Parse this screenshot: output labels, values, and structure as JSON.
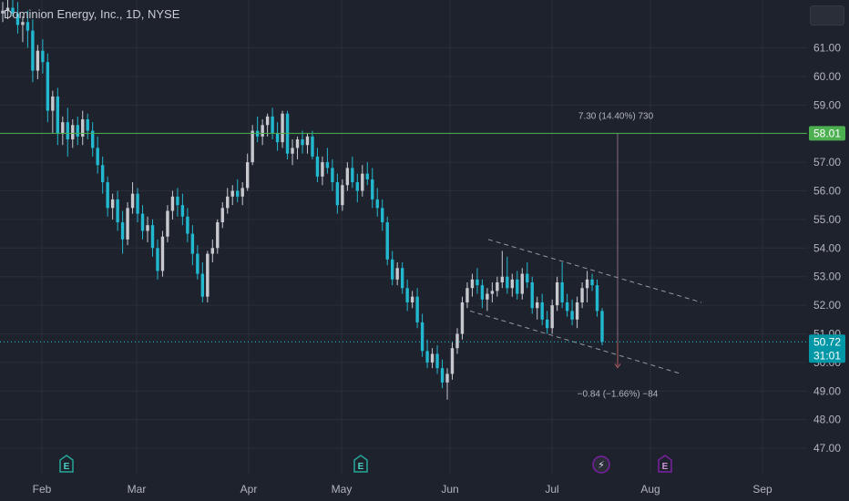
{
  "header": {
    "title": "Dominion Energy, Inc., 1D, NYSE"
  },
  "colors": {
    "background": "#1e222d",
    "up": "#c7c9cf",
    "down": "#22b8cf",
    "resistance_line": "#4caf50",
    "price_line": "#26c6da",
    "grid": "#2a2e39",
    "axis_text": "#b2b5be",
    "channel": "#9598a1",
    "earnings_badge": "#26a69a",
    "dividend_badge": "#7b1fa2"
  },
  "chart_data": {
    "type": "candlestick",
    "title": "Dominion Energy, Inc., 1D, NYSE",
    "ylim": [
      46.6,
      62.1
    ],
    "y_ticks": [
      "61.00",
      "60.00",
      "59.00",
      "58.00",
      "57.00",
      "56.00",
      "55.00",
      "54.00",
      "53.00",
      "52.00",
      "51.00",
      "50.00",
      "49.00",
      "48.00",
      "47.00"
    ],
    "x_ticks": [
      "Feb",
      "Mar",
      "Apr",
      "May",
      "Jun",
      "Jul",
      "Aug",
      "Sep"
    ],
    "horizontal_line": {
      "value": 58.01,
      "label": "58.01"
    },
    "last_price": {
      "value": 50.72,
      "label": "50.72",
      "countdown": "31:01"
    },
    "measure_annotations": {
      "up": "7.30 (14.40%) 730",
      "down": "−0.84 (−1.66%) −84"
    },
    "event_badges": [
      {
        "type": "earnings",
        "label": "E",
        "month": "Feb"
      },
      {
        "type": "earnings",
        "label": "E",
        "month": "May"
      },
      {
        "type": "lightning",
        "label": "⚡",
        "month": "Jul"
      },
      {
        "type": "dividend",
        "label": "E",
        "month": "Aug"
      }
    ],
    "candles": [
      [
        62.2,
        62.6,
        61.9,
        62.3
      ],
      [
        62.3,
        62.7,
        62.0,
        62.4
      ],
      [
        62.4,
        62.8,
        62.1,
        62.2
      ],
      [
        62.2,
        62.6,
        61.5,
        61.8
      ],
      [
        61.8,
        62.1,
        61.2,
        61.9
      ],
      [
        61.9,
        62.3,
        61.0,
        61.6
      ],
      [
        61.6,
        62.0,
        59.8,
        60.2
      ],
      [
        60.2,
        61.1,
        59.9,
        60.9
      ],
      [
        60.9,
        61.3,
        60.1,
        60.5
      ],
      [
        60.5,
        60.8,
        58.4,
        58.8
      ],
      [
        58.8,
        59.5,
        58.0,
        59.3
      ],
      [
        59.3,
        59.6,
        57.6,
        58.0
      ],
      [
        58.0,
        58.6,
        57.6,
        58.4
      ],
      [
        58.4,
        58.9,
        57.2,
        57.8
      ],
      [
        57.8,
        58.5,
        57.5,
        58.3
      ],
      [
        58.3,
        58.6,
        57.6,
        57.9
      ],
      [
        57.9,
        58.8,
        57.6,
        58.5
      ],
      [
        58.5,
        58.7,
        57.8,
        58.1
      ],
      [
        58.1,
        58.4,
        57.2,
        57.5
      ],
      [
        57.5,
        57.9,
        56.6,
        56.9
      ],
      [
        56.9,
        57.2,
        55.9,
        56.3
      ],
      [
        56.3,
        56.5,
        55.1,
        55.4
      ],
      [
        55.4,
        55.9,
        55.0,
        55.7
      ],
      [
        55.7,
        56.0,
        54.6,
        54.9
      ],
      [
        54.9,
        55.3,
        53.8,
        54.3
      ],
      [
        54.3,
        55.6,
        54.1,
        55.4
      ],
      [
        55.4,
        56.3,
        55.2,
        55.9
      ],
      [
        55.9,
        56.1,
        54.9,
        55.2
      ],
      [
        55.2,
        55.5,
        54.3,
        54.6
      ],
      [
        54.6,
        55.1,
        54.2,
        54.8
      ],
      [
        54.8,
        55.0,
        53.7,
        54.0
      ],
      [
        54.0,
        54.3,
        52.9,
        53.2
      ],
      [
        53.2,
        54.6,
        53.0,
        54.4
      ],
      [
        54.4,
        55.5,
        54.2,
        55.3
      ],
      [
        55.3,
        56.0,
        55.0,
        55.8
      ],
      [
        55.8,
        56.1,
        55.1,
        55.5
      ],
      [
        55.5,
        55.9,
        54.8,
        55.1
      ],
      [
        55.1,
        55.4,
        54.2,
        54.5
      ],
      [
        54.5,
        54.8,
        53.4,
        53.8
      ],
      [
        53.8,
        54.1,
        52.9,
        53.1
      ],
      [
        53.1,
        53.5,
        52.1,
        52.3
      ],
      [
        52.3,
        53.9,
        52.1,
        53.8
      ],
      [
        53.8,
        54.3,
        53.5,
        54.0
      ],
      [
        54.0,
        55.0,
        53.8,
        54.9
      ],
      [
        54.9,
        55.6,
        54.7,
        55.4
      ],
      [
        55.4,
        56.1,
        55.2,
        55.8
      ],
      [
        55.8,
        56.2,
        55.5,
        56.0
      ],
      [
        56.0,
        56.4,
        55.6,
        55.8
      ],
      [
        55.8,
        56.3,
        55.5,
        56.1
      ],
      [
        56.1,
        57.3,
        56.0,
        57.0
      ],
      [
        57.0,
        58.3,
        56.9,
        58.1
      ],
      [
        58.1,
        58.6,
        57.7,
        57.9
      ],
      [
        57.9,
        58.5,
        57.6,
        58.3
      ],
      [
        58.3,
        58.7,
        57.9,
        58.6
      ],
      [
        58.6,
        58.9,
        57.8,
        58.0
      ],
      [
        58.0,
        58.4,
        57.4,
        57.7
      ],
      [
        57.7,
        58.8,
        57.5,
        58.7
      ],
      [
        58.7,
        58.8,
        57.1,
        57.3
      ],
      [
        57.3,
        57.8,
        56.9,
        57.5
      ],
      [
        57.5,
        57.9,
        57.1,
        57.8
      ],
      [
        57.8,
        58.1,
        57.3,
        57.6
      ],
      [
        57.6,
        58.0,
        57.3,
        57.9
      ],
      [
        57.9,
        58.1,
        57.1,
        57.2
      ],
      [
        57.2,
        57.5,
        56.3,
        56.5
      ],
      [
        56.5,
        57.2,
        56.2,
        57.0
      ],
      [
        57.0,
        57.5,
        56.6,
        56.8
      ],
      [
        56.8,
        57.1,
        56.0,
        56.3
      ],
      [
        56.3,
        56.6,
        55.2,
        55.5
      ],
      [
        55.5,
        56.4,
        55.3,
        56.2
      ],
      [
        56.2,
        57.0,
        56.0,
        56.8
      ],
      [
        56.8,
        57.2,
        56.1,
        56.3
      ],
      [
        56.3,
        56.6,
        55.6,
        56.0
      ],
      [
        56.0,
        56.9,
        55.8,
        56.6
      ],
      [
        56.6,
        57.0,
        56.2,
        56.4
      ],
      [
        56.4,
        56.8,
        55.4,
        55.7
      ],
      [
        55.7,
        56.1,
        55.1,
        55.4
      ],
      [
        55.4,
        55.7,
        54.6,
        54.9
      ],
      [
        54.9,
        55.1,
        53.4,
        53.6
      ],
      [
        53.6,
        53.9,
        52.7,
        52.9
      ],
      [
        52.9,
        53.5,
        52.7,
        53.3
      ],
      [
        53.3,
        53.5,
        52.4,
        52.6
      ],
      [
        52.6,
        52.9,
        51.8,
        52.1
      ],
      [
        52.1,
        52.5,
        51.9,
        52.3
      ],
      [
        52.3,
        52.6,
        51.2,
        51.4
      ],
      [
        51.4,
        51.7,
        50.2,
        50.4
      ],
      [
        50.4,
        50.8,
        49.8,
        50.0
      ],
      [
        50.0,
        50.5,
        49.8,
        50.3
      ],
      [
        50.3,
        50.6,
        49.6,
        49.8
      ],
      [
        49.8,
        50.1,
        49.1,
        49.3
      ],
      [
        49.3,
        49.8,
        48.7,
        49.6
      ],
      [
        49.6,
        50.7,
        49.4,
        50.5
      ],
      [
        50.5,
        51.2,
        50.3,
        51.0
      ],
      [
        51.0,
        52.3,
        50.8,
        52.1
      ],
      [
        52.1,
        52.8,
        51.9,
        52.6
      ],
      [
        52.6,
        53.1,
        52.3,
        52.9
      ],
      [
        52.9,
        53.3,
        52.4,
        52.7
      ],
      [
        52.7,
        52.9,
        51.9,
        52.2
      ],
      [
        52.2,
        52.6,
        51.8,
        52.4
      ],
      [
        52.4,
        52.8,
        52.1,
        52.5
      ],
      [
        52.5,
        53.0,
        52.3,
        52.8
      ],
      [
        52.8,
        53.9,
        52.6,
        53.0
      ],
      [
        53.0,
        53.7,
        52.4,
        52.6
      ],
      [
        52.6,
        53.1,
        52.3,
        52.9
      ],
      [
        52.9,
        53.2,
        52.2,
        52.4
      ],
      [
        52.4,
        53.3,
        52.2,
        53.1
      ],
      [
        53.1,
        53.5,
        52.6,
        52.8
      ],
      [
        52.8,
        53.0,
        51.7,
        51.9
      ],
      [
        51.9,
        52.3,
        51.5,
        52.1
      ],
      [
        52.1,
        52.4,
        51.3,
        51.5
      ],
      [
        51.5,
        51.8,
        51.0,
        51.2
      ],
      [
        51.2,
        52.2,
        51.0,
        52.0
      ],
      [
        52.0,
        53.0,
        51.8,
        52.8
      ],
      [
        52.8,
        53.5,
        51.9,
        52.1
      ],
      [
        52.1,
        52.4,
        51.6,
        51.8
      ],
      [
        51.8,
        52.2,
        51.3,
        51.5
      ],
      [
        51.5,
        52.3,
        51.2,
        52.1
      ],
      [
        52.1,
        52.8,
        51.9,
        52.6
      ],
      [
        52.6,
        53.2,
        52.1,
        52.9
      ],
      [
        52.9,
        53.1,
        52.5,
        52.7
      ],
      [
        52.7,
        52.9,
        51.6,
        51.8
      ],
      [
        51.8,
        51.9,
        50.6,
        50.72
      ]
    ]
  }
}
